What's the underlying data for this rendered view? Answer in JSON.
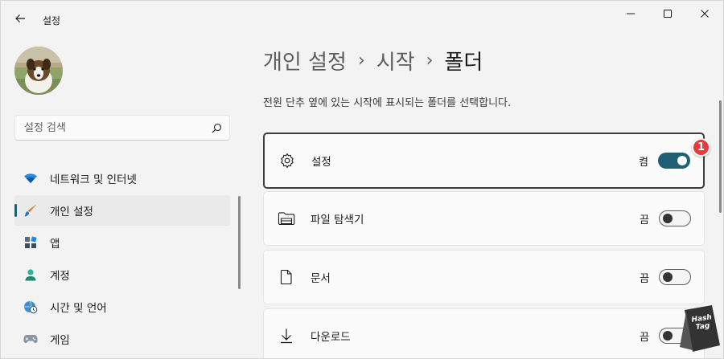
{
  "titlebar": {
    "app_title": "설정",
    "back_icon": "arrow-left-icon",
    "minimize_icon": "minimize-icon",
    "maximize_icon": "maximize-icon",
    "close_icon": "close-icon"
  },
  "sidebar": {
    "search": {
      "placeholder": "설정 검색",
      "icon": "search-icon"
    },
    "items": [
      {
        "label": "네트워크 및 인터넷",
        "icon": "wifi-icon",
        "active": false
      },
      {
        "label": "개인 설정",
        "icon": "paintbrush-icon",
        "active": true
      },
      {
        "label": "앱",
        "icon": "apps-icon",
        "active": false
      },
      {
        "label": "계정",
        "icon": "person-icon",
        "active": false
      },
      {
        "label": "시간 및 언어",
        "icon": "globe-clock-icon",
        "active": false
      },
      {
        "label": "게임",
        "icon": "gamepad-icon",
        "active": false
      }
    ]
  },
  "main": {
    "breadcrumb": {
      "parent": "개인 설정",
      "middle": "시작",
      "current": "폴더",
      "separator": "›"
    },
    "description": "전원 단추 옆에 있는 시작에 표시되는 폴더를 선택합니다.",
    "folders": [
      {
        "label": "설정",
        "icon": "gear-icon",
        "state": "켬",
        "on": true
      },
      {
        "label": "파일 탐색기",
        "icon": "folder-icon",
        "state": "끔",
        "on": false
      },
      {
        "label": "문서",
        "icon": "document-icon",
        "state": "끔",
        "on": false
      },
      {
        "label": "다운로드",
        "icon": "download-icon",
        "state": "끔",
        "on": false
      }
    ],
    "annotation_badge": "1"
  },
  "watermark": {
    "text": "Hash Tag"
  },
  "colors": {
    "accent": "#1e5f74",
    "badge": "#e63b3b",
    "background": "#f3f3f3",
    "card": "#fbfbfb"
  }
}
